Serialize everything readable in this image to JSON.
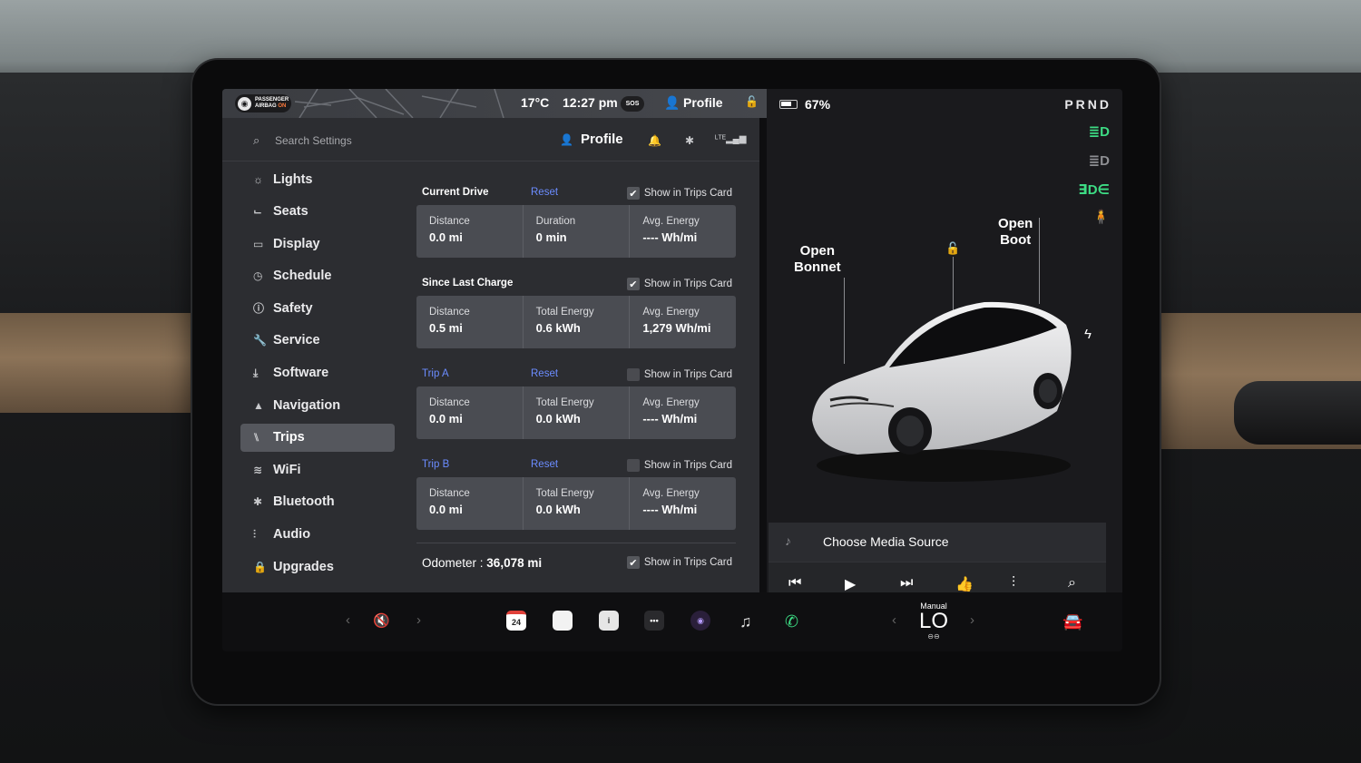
{
  "statusbar": {
    "airbag_line1": "PASSENGER",
    "airbag_line2": "AIRBAG",
    "airbag_on": "ON",
    "temperature": "17°C",
    "time": "12:27 pm",
    "sos": "SOS",
    "profile": "Profile"
  },
  "search": {
    "placeholder": "Search Settings"
  },
  "header": {
    "profile_label": "Profile"
  },
  "sidebar": {
    "items": [
      {
        "label": "Lights",
        "icon": "sun-icon"
      },
      {
        "label": "Seats",
        "icon": "seat-icon"
      },
      {
        "label": "Display",
        "icon": "display-icon"
      },
      {
        "label": "Schedule",
        "icon": "clock-icon"
      },
      {
        "label": "Safety",
        "icon": "safety-icon"
      },
      {
        "label": "Service",
        "icon": "wrench-icon"
      },
      {
        "label": "Software",
        "icon": "download-icon"
      },
      {
        "label": "Navigation",
        "icon": "navigation-icon"
      },
      {
        "label": "Trips",
        "icon": "trips-icon"
      },
      {
        "label": "WiFi",
        "icon": "wifi-icon"
      },
      {
        "label": "Bluetooth",
        "icon": "bluetooth-icon"
      },
      {
        "label": "Audio",
        "icon": "equalizer-icon"
      },
      {
        "label": "Upgrades",
        "icon": "lock-icon"
      }
    ],
    "active": "Trips"
  },
  "trips": {
    "show_label": "Show in Trips Card",
    "reset_label": "Reset",
    "current_drive": {
      "title": "Current Drive",
      "show_checked": true,
      "tiles": [
        {
          "label": "Distance",
          "value": "0.0 mi"
        },
        {
          "label": "Duration",
          "value": "0 min"
        },
        {
          "label": "Avg. Energy",
          "value": "---- Wh/mi"
        }
      ]
    },
    "since_last_charge": {
      "title": "Since Last Charge",
      "show_checked": true,
      "tiles": [
        {
          "label": "Distance",
          "value": "0.5 mi"
        },
        {
          "label": "Total Energy",
          "value": "0.6 kWh"
        },
        {
          "label": "Avg. Energy",
          "value": "1,279 Wh/mi"
        }
      ]
    },
    "trip_a": {
      "title": "Trip A",
      "show_checked": false,
      "tiles": [
        {
          "label": "Distance",
          "value": "0.0 mi"
        },
        {
          "label": "Total Energy",
          "value": "0.0 kWh"
        },
        {
          "label": "Avg. Energy",
          "value": "---- Wh/mi"
        }
      ]
    },
    "trip_b": {
      "title": "Trip B",
      "show_checked": false,
      "tiles": [
        {
          "label": "Distance",
          "value": "0.0 mi"
        },
        {
          "label": "Total Energy",
          "value": "0.0 kWh"
        },
        {
          "label": "Avg. Energy",
          "value": "---- Wh/mi"
        }
      ]
    },
    "odometer_label": "Odometer :",
    "odometer_value": "36,078 mi",
    "odometer_show_checked": true
  },
  "car": {
    "battery": "67%",
    "gear": "PRND",
    "open_bonnet_1": "Open",
    "open_bonnet_2": "Bonnet",
    "open_boot_1": "Open",
    "open_boot_2": "Boot",
    "accent_green": "#3ddc84",
    "accent_red": "#e8413a"
  },
  "media": {
    "title": "Choose Media Source"
  },
  "dock": {
    "calendar_day": "24",
    "climate_mode": "Manual",
    "climate_temp": "LO"
  }
}
